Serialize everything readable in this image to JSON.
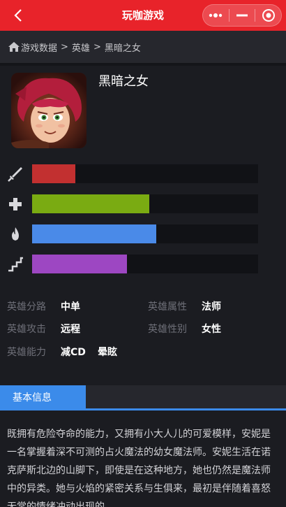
{
  "app": {
    "title": "玩咖游戏"
  },
  "breadcrumb": {
    "items": [
      "游戏数据",
      "英雄",
      "黑暗之女"
    ],
    "separator": ">"
  },
  "hero": {
    "name": "黑暗之女",
    "stats": [
      {
        "icon": "sword-icon",
        "level": 0.19,
        "color": "#c23030"
      },
      {
        "icon": "plus-icon",
        "level": 0.52,
        "color": "#7aab12"
      },
      {
        "icon": "flame-icon",
        "level": 0.55,
        "color": "#4a8ae8"
      },
      {
        "icon": "stairs-icon",
        "level": 0.42,
        "color": "#9d47c2"
      }
    ],
    "attributes": {
      "lane_label": "英雄分路",
      "lane_value": "中单",
      "type_label": "英雄属性",
      "type_value": "法师",
      "attack_label": "英雄攻击",
      "attack_value": "远程",
      "gender_label": "英雄性别",
      "gender_value": "女性",
      "ability_label": "英雄能力",
      "ability_values": [
        "减CD",
        "晕眩"
      ]
    }
  },
  "tabs": {
    "basic_info": "基本信息"
  },
  "description": "既拥有危险夺命的能力，又拥有小大人儿的可爱模样，安妮是一名掌握着深不可测的占火魔法的幼女魔法师。安妮生活在诺克萨斯北边的山脚下，即使是在这种地方，她也仍然是魔法师中的异类。她与火焰的紧密关系与生俱来，最初是伴随着喜怒无常的情绪冲动出现的"
}
